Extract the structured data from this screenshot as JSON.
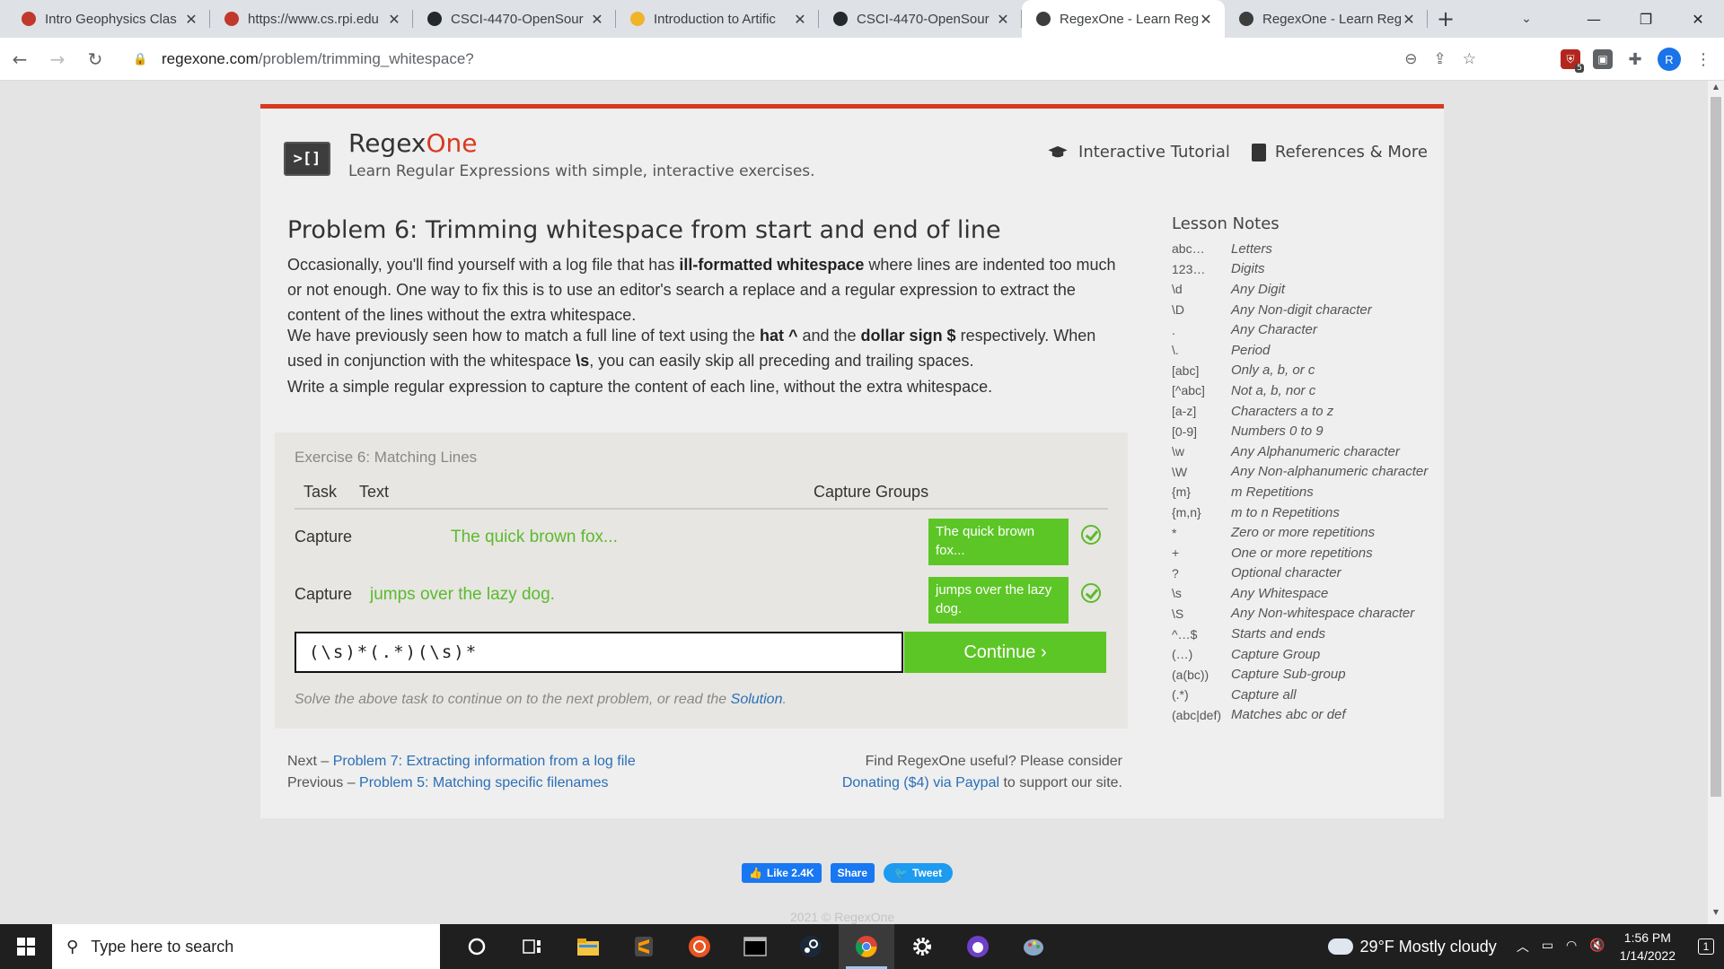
{
  "browser": {
    "tabs": [
      {
        "title": "Intro Geophysics Clas",
        "favicon": "rpi-icon",
        "color": "#c0392b",
        "active": false
      },
      {
        "title": "https://www.cs.rpi.edu",
        "favicon": "cs-icon",
        "color": "#c0392b",
        "active": false
      },
      {
        "title": "CSCI-4470-OpenSour",
        "favicon": "github-icon",
        "color": "#24292e",
        "active": false
      },
      {
        "title": "Introduction to Artific",
        "favicon": "hand-icon",
        "color": "#f0b429",
        "active": false
      },
      {
        "title": "CSCI-4470-OpenSour",
        "favicon": "github-icon",
        "color": "#24292e",
        "active": false
      },
      {
        "title": "RegexOne - Learn Reg",
        "favicon": "regexone-icon",
        "color": "#3d3d3d",
        "active": true
      },
      {
        "title": "RegexOne - Learn Reg",
        "favicon": "regexone-icon",
        "color": "#3d3d3d",
        "active": false
      }
    ],
    "url_host": "regexone.com",
    "url_path": "/problem/trimming_whitespace?",
    "profile_initial": "R",
    "ext_badge": "5"
  },
  "site": {
    "brand_main": "Regex",
    "brand_accent": "One",
    "logo_text": ">[]",
    "tagline": "Learn Regular Expressions with simple, interactive exercises.",
    "nav": {
      "tutorial": "Interactive Tutorial",
      "references": "References & More"
    }
  },
  "problem": {
    "title": "Problem 6: Trimming whitespace from start and end of line",
    "p1": {
      "before": "Occasionally, you'll find yourself with a log file that has ",
      "bold": "ill-formatted whitespace",
      "after": " where lines are indented too much or not enough. One way to fix this is to use an editor's search a replace and a regular expression to extract the content of the lines without the extra whitespace."
    },
    "p2": {
      "a": "We have previously seen how to match a full line of text using the ",
      "b1": "hat ^",
      "c": " and the ",
      "b2": "dollar sign $",
      "d": " respectively. When used in conjunction with the whitespace ",
      "b3": "\\s",
      "e": ", you can easily skip all preceding and trailing spaces."
    },
    "p3": "Write a simple regular expression to capture the content of each line, without the extra whitespace."
  },
  "exercise": {
    "title": "Exercise 6: Matching Lines",
    "col_task": "Task",
    "col_text": "Text",
    "col_groups": "Capture Groups",
    "rows": [
      {
        "task": "Capture",
        "text": "The quick brown fox...",
        "group": "The quick brown fox...",
        "status": "matched"
      },
      {
        "task": "Capture",
        "text": "jumps over the lazy dog.",
        "group": "jumps over the lazy dog.",
        "status": "matched"
      }
    ],
    "input_value": "(\\s)*(.*)(\\s)*",
    "continue_label": "Continue ›",
    "hint_before": "Solve the above task to continue on to the next problem, or read the ",
    "hint_link": "Solution",
    "hint_after": "."
  },
  "footer": {
    "next_prefix": "Next – ",
    "next_link": "Problem 7: Extracting information from a log file",
    "prev_prefix": "Previous – ",
    "prev_link": "Problem 5: Matching specific filenames",
    "donate_line1": "Find RegexOne useful? Please consider",
    "donate_link": "Donating ($4) via Paypal",
    "donate_after": " to support our site.",
    "like": "Like 2.4K",
    "share": "Share",
    "tweet": "Tweet",
    "copyright": "2021 © RegexOne"
  },
  "lesson_notes": {
    "title": "Lesson Notes",
    "items": [
      {
        "key": "abc…",
        "val": "Letters"
      },
      {
        "key": "123…",
        "val": "Digits"
      },
      {
        "key": "\\d",
        "val": "Any Digit"
      },
      {
        "key": "\\D",
        "val": "Any Non-digit character"
      },
      {
        "key": ".",
        "val": "Any Character"
      },
      {
        "key": "\\.",
        "val": "Period"
      },
      {
        "key": "[abc]",
        "val": "Only a, b, or c"
      },
      {
        "key": "[^abc]",
        "val": "Not a, b, nor c"
      },
      {
        "key": "[a-z]",
        "val": "Characters a to z"
      },
      {
        "key": "[0-9]",
        "val": "Numbers 0 to 9"
      },
      {
        "key": "\\w",
        "val": "Any Alphanumeric character"
      },
      {
        "key": "\\W",
        "val": "Any Non-alphanumeric character"
      },
      {
        "key": "{m}",
        "val": "m Repetitions"
      },
      {
        "key": "{m,n}",
        "val": "m to n Repetitions"
      },
      {
        "key": "*",
        "val": "Zero or more repetitions"
      },
      {
        "key": "+",
        "val": "One or more repetitions"
      },
      {
        "key": "?",
        "val": "Optional character"
      },
      {
        "key": "\\s",
        "val": "Any Whitespace"
      },
      {
        "key": "\\S",
        "val": "Any Non-whitespace character"
      },
      {
        "key": "^…$",
        "val": "Starts and ends"
      },
      {
        "key": "(…)",
        "val": "Capture Group"
      },
      {
        "key": "(a(bc))",
        "val": "Capture Sub-group"
      },
      {
        "key": "(.*)",
        "val": "Capture all"
      },
      {
        "key": "(abc|def)",
        "val": "Matches abc or def"
      }
    ]
  },
  "taskbar": {
    "search_placeholder": "Type here to search",
    "weather": "29°F  Mostly cloudy",
    "time": "1:56 PM",
    "date": "1/14/2022",
    "notif_count": "1"
  },
  "colors": {
    "accent": "#d9391f",
    "success": "#5cc626",
    "link": "#2a6fb6"
  }
}
